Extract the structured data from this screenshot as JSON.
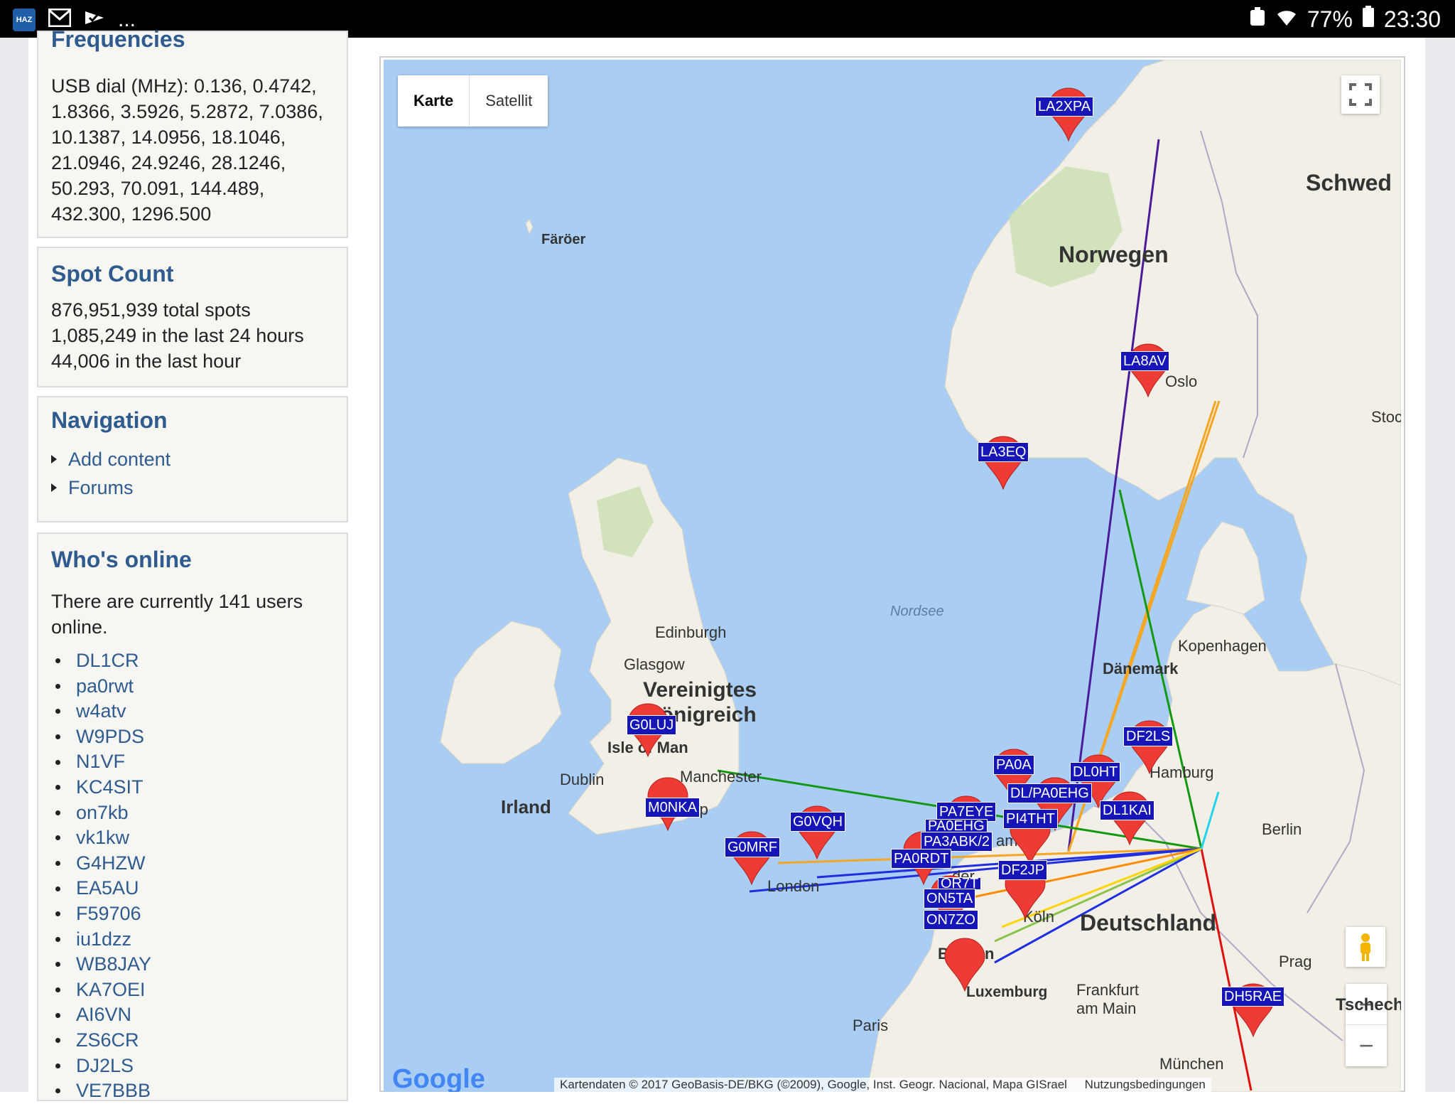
{
  "statusbar": {
    "notif_icons": [
      "haz-app-icon",
      "gmail-icon",
      "checklist-icon"
    ],
    "more": "...",
    "battery": "77%",
    "time": "23:30"
  },
  "sidebar": {
    "frequencies": {
      "title": "Frequencies",
      "lines": [
        "USB dial (MHz): 0.136, 0.4742,",
        "1.8366, 3.5926, 5.2872, 7.0386,",
        "10.1387, 14.0956, 18.1046,",
        "21.0946, 24.9246, 28.1246,",
        "50.293, 70.091, 144.489,",
        "432.300, 1296.500"
      ]
    },
    "spot_count": {
      "title": "Spot Count",
      "lines": [
        "876,951,939 total spots",
        "1,085,249 in the last 24 hours",
        "44,006 in the last hour"
      ]
    },
    "navigation": {
      "title": "Navigation",
      "items": [
        "Add content",
        "Forums"
      ]
    },
    "whos_online": {
      "title": "Who's online",
      "text": [
        "There are currently 141 users",
        "online."
      ],
      "users": [
        "DL1CR",
        "pa0rwt",
        "w4atv",
        "W9PDS",
        "N1VF",
        "KC4SIT",
        "on7kb",
        "vk1kw",
        "G4HZW",
        "EA5AU",
        "F59706",
        "iu1dzz",
        "WB8JAY",
        "KA7OEI",
        "AI6VN",
        "ZS6CR",
        "DJ2LS",
        "VE7BBB"
      ]
    }
  },
  "map": {
    "toggle": {
      "map": "Karte",
      "satellite": "Satellit"
    },
    "fullscreen_icon": "fullscreen-icon",
    "pegman_icon": "pegman-icon",
    "zoom_in": "+",
    "zoom_out": "−",
    "logo": "Google",
    "attribution": "Kartendaten © 2017 GeoBasis-DE/BKG (©2009), Google, Inst. Geogr. Nacional, Mapa GISrael",
    "terms": "Nutzungsbedingungen",
    "places": {
      "faroer": "Färöer",
      "norwegen": "Norwegen",
      "schweden": "Schwed",
      "oslo": "Oslo",
      "stockholm": "Stoc",
      "nordsee": "Nordsee",
      "edinburgh": "Edinburgh",
      "glasgow": "Glasgow",
      "uk1": "Vereinigtes",
      "uk2": "Königreich",
      "isle_of_man": "Isle of Man",
      "dublin": "Dublin",
      "irland": "Irland",
      "manchester": "Manchester",
      "liverpool": "Liverp",
      "london": "London",
      "daenemark": "Dänemark",
      "kopenhagen": "Kopenhagen",
      "hamburg": "Hamburg",
      "berlin": "Berlin",
      "deutschland": "Deutschland",
      "koeln": "Köln",
      "belgien": "Belgien",
      "luxemburg": "Luxemburg",
      "frankfurt1": "Frankfurt",
      "frankfurt2": "am Main",
      "paris": "Paris",
      "prag": "Prag",
      "tschechien": "Tschechi",
      "muenchen": "München",
      "am": "am",
      "der": "der"
    },
    "stations": [
      "LA2XPA",
      "LA8AV",
      "LA3EQ",
      "G0LUJ",
      "M0NKA",
      "G0VQH",
      "G0MRF",
      "PA0A",
      "DL0HT",
      "DF2LS",
      "DL/PA0EHG",
      "DL1KAI",
      "PA7EYE",
      "PA0EHG",
      "PI4THT",
      "PA3ABK/2",
      "PA0RDT",
      "DF2JP",
      "OR7T",
      "ON5TA",
      "ON7ZO",
      "DH5RAE"
    ]
  }
}
